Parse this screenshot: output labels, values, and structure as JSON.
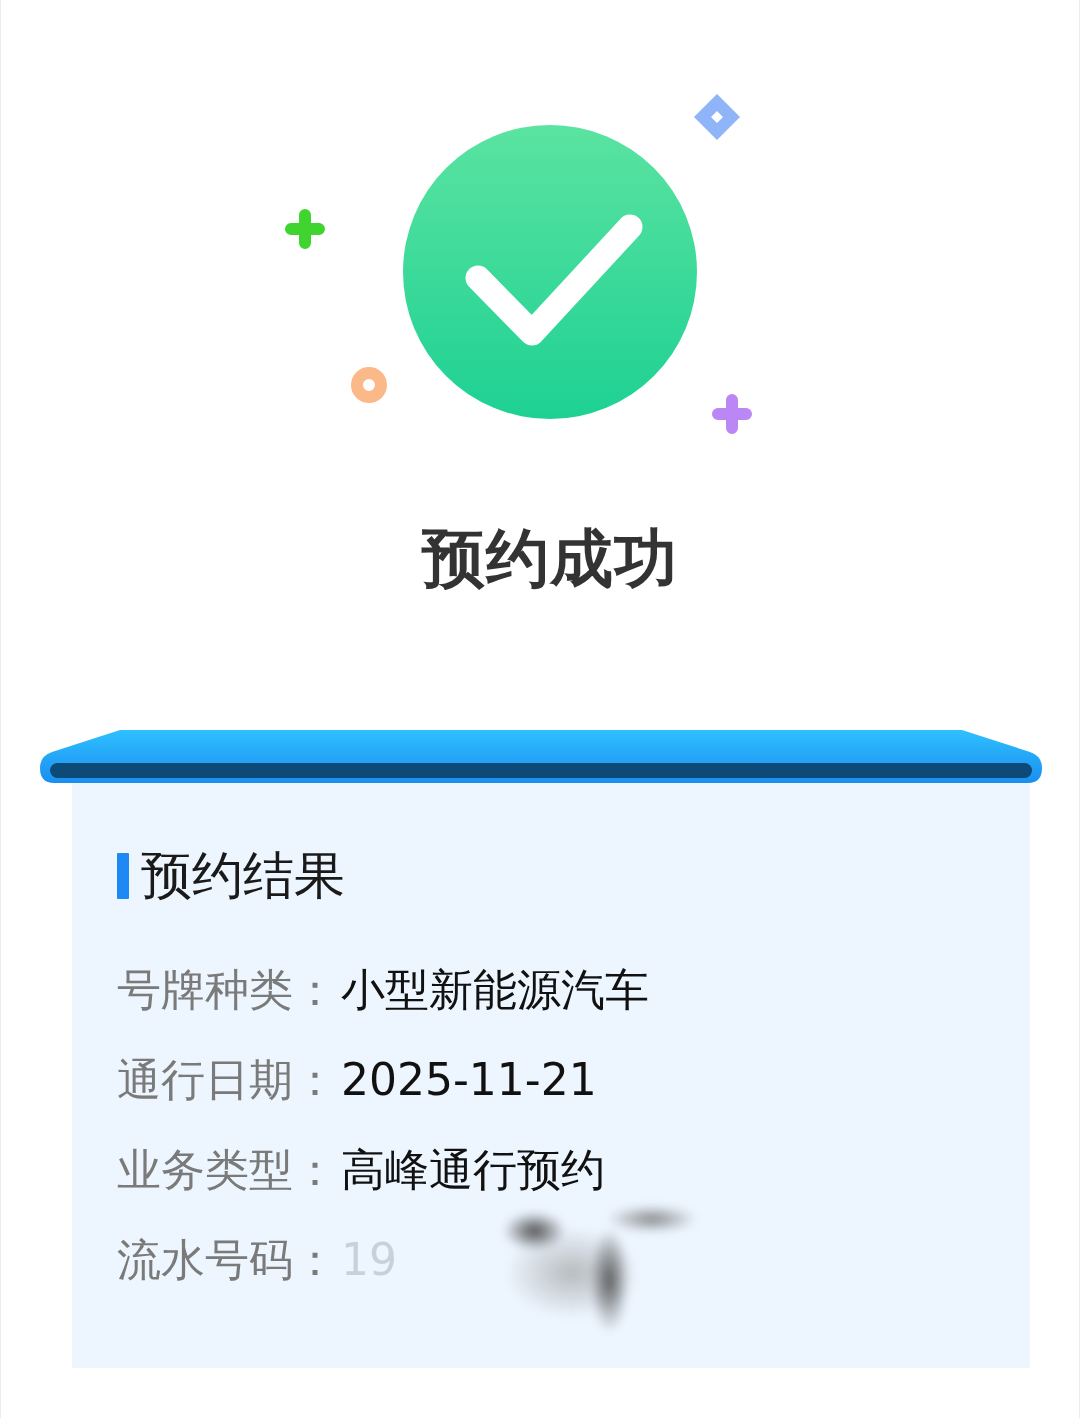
{
  "status": {
    "title": "预约成功"
  },
  "result_card": {
    "heading": "预约结果",
    "fields": [
      {
        "label": "号牌种类：",
        "value": "小型新能源汽车",
        "redacted": false
      },
      {
        "label": "通行日期：",
        "value": "2025-11-21",
        "redacted": false
      },
      {
        "label": "业务类型：",
        "value": "高峰通行预约",
        "redacted": false
      },
      {
        "label": "流水号码：",
        "value": "19",
        "redacted": true
      }
    ]
  }
}
